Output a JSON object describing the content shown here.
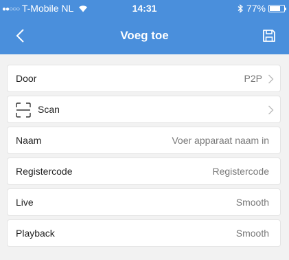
{
  "status_bar": {
    "carrier_dots": "●●○○○",
    "carrier": "T-Mobile NL",
    "wifi_icon": "wifi-icon",
    "time": "14:31",
    "bluetooth_icon": "bluetooth-icon",
    "battery_text": "77%",
    "battery_level": 0.77
  },
  "header": {
    "title": "Voeg toe",
    "back_icon": "chevron-left-icon",
    "save_icon": "save-icon",
    "color": "#4a8fdc"
  },
  "form": {
    "door": {
      "label": "Door",
      "value": "P2P"
    },
    "scan": {
      "label": "Scan",
      "icon": "scan-icon"
    },
    "naam": {
      "label": "Naam",
      "placeholder": "Voer apparaat naam in"
    },
    "registercode": {
      "label": "Registercode",
      "placeholder": "Registercode"
    },
    "live": {
      "label": "Live",
      "value": "Smooth"
    },
    "playback": {
      "label": "Playback",
      "value": "Smooth"
    }
  }
}
